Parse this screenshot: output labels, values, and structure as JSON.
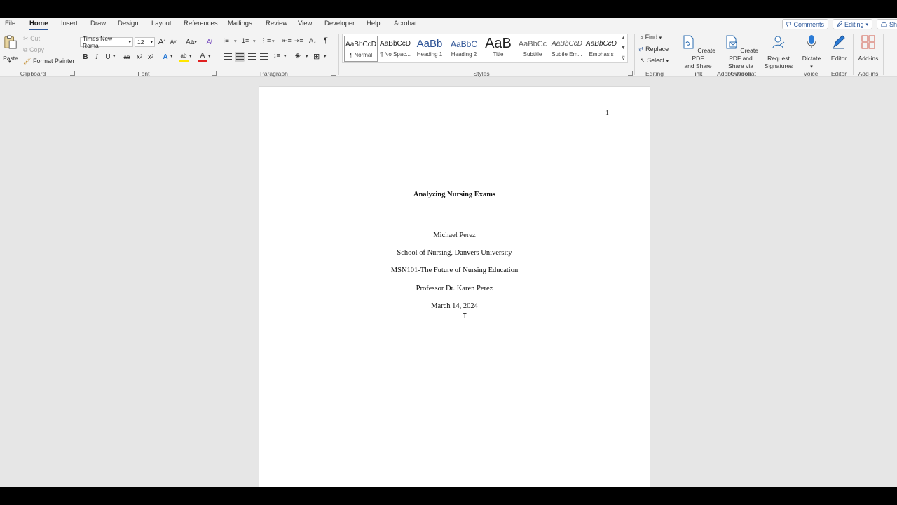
{
  "menu": {
    "tabs": [
      "File",
      "Home",
      "Insert",
      "Draw",
      "Design",
      "Layout",
      "References",
      "Mailings",
      "Review",
      "View",
      "Developer",
      "Help",
      "Acrobat"
    ],
    "active": "Home",
    "comments_label": "Comments",
    "editing_label": "Editing",
    "share_label": "Sha"
  },
  "clipboard": {
    "paste": "Paste",
    "cut": "Cut",
    "copy": "Copy",
    "format_painter": "Format Painter",
    "group": "Clipboard"
  },
  "font": {
    "name": "Times New Roma",
    "size": "12",
    "group": "Font",
    "case_btn": "Aa",
    "grow": "A",
    "shrink": "A",
    "bold": "B",
    "italic": "I",
    "underline": "U",
    "strike": "ab",
    "sub": "x",
    "sup": "x",
    "effects": "A",
    "highlight": "ab",
    "color": "A"
  },
  "paragraph": {
    "group": "Paragraph",
    "pilcrow": "¶"
  },
  "styles": {
    "group": "Styles",
    "items": [
      {
        "sample": "AaBbCcD",
        "name": "¶ Normal"
      },
      {
        "sample": "AaBbCcD",
        "name": "¶ No Spac..."
      },
      {
        "sample": "AaBb",
        "name": "Heading 1"
      },
      {
        "sample": "AaBbC",
        "name": "Heading 2"
      },
      {
        "sample": "AaB",
        "name": "Title"
      },
      {
        "sample": "AaBbCc",
        "name": "Subtitle"
      },
      {
        "sample": "AaBbCcD",
        "name": "Subtle Em..."
      },
      {
        "sample": "AaBbCcD",
        "name": "Emphasis"
      }
    ],
    "selected": 0
  },
  "editing": {
    "group": "Editing",
    "find": "Find",
    "replace": "Replace",
    "select": "Select"
  },
  "acrobat": {
    "group": "Adobe Acrobat",
    "create_pdf_line1": "Create PDF",
    "create_pdf_line2": "and Share link",
    "outlook_line1": "Create PDF and",
    "outlook_line2": "Share via Outlook",
    "request_line1": "Request",
    "request_line2": "Signatures"
  },
  "voice": {
    "group": "Voice",
    "dictate": "Dictate"
  },
  "editor": {
    "group": "Editor",
    "label": "Editor"
  },
  "addins": {
    "group": "Add-ins",
    "label": "Add-ins"
  },
  "document": {
    "page_number": "1",
    "title": "Analyzing Nursing Exams",
    "author": "Michael Perez",
    "institution": "School of Nursing, Danvers University",
    "course": "MSN101-The Future of Nursing Education",
    "instructor": "Professor Dr. Karen Perez",
    "date": "March 14, 2024"
  },
  "colors": {
    "accent": "#2b579a",
    "ribbon_bg": "#f3f3f3",
    "canvas_bg": "#e6e6e6",
    "highlight_yellow": "#ffe600",
    "font_red": "#e02020"
  }
}
